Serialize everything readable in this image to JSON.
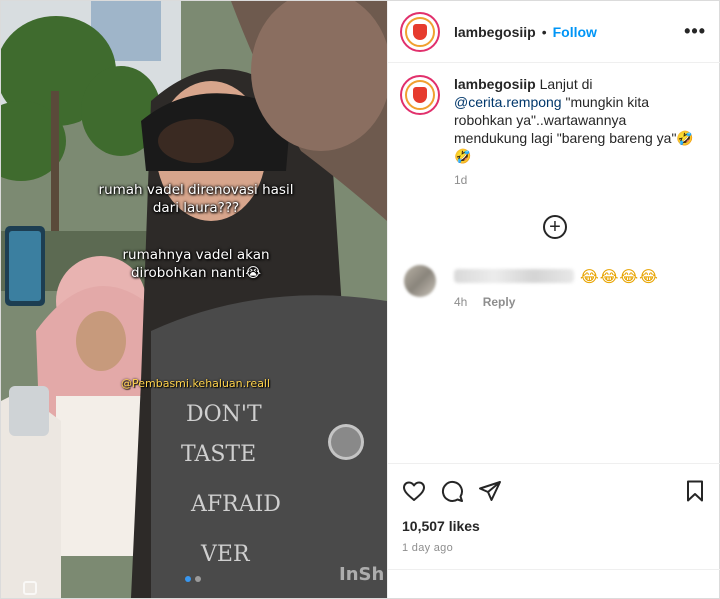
{
  "media": {
    "overlay_line1": "rumah vadel direnovasi hasil dari laura???",
    "overlay_line2": "rumahnya vadel akan dirobohkan nanti😭",
    "overlay_handle": "@Pembasmi.kehaluan.reall",
    "watermark": "InSh",
    "carousel_count": 2,
    "carousel_active": 1
  },
  "header": {
    "username": "lambegosiip",
    "separator": "•",
    "follow_label": "Follow",
    "more_icon": "ellipsis-icon"
  },
  "caption": {
    "username": "lambegosiip",
    "text_before_mention": "Lanjut di",
    "mention": "@cerita.rempong",
    "text_after_mention": "\"mungkin kita robohkan ya\"..wartawannya mendukung lagi \"bareng bareng ya\"🤣🤣",
    "time": "1d"
  },
  "load_more_icon": "plus-circle-icon",
  "comment": {
    "emoji": "😂😂😂😂",
    "time": "4h",
    "reply_label": "Reply"
  },
  "actions": {
    "like_icon": "heart-icon",
    "comment_icon": "comment-icon",
    "share_icon": "paper-plane-icon",
    "save_icon": "bookmark-icon"
  },
  "likes": "10,507 likes",
  "date": "1 day ago",
  "colors": {
    "link_blue": "#0095f6",
    "mention_blue": "#00376b",
    "muted_gray": "#8e8e8e",
    "text_dark": "#262626"
  }
}
